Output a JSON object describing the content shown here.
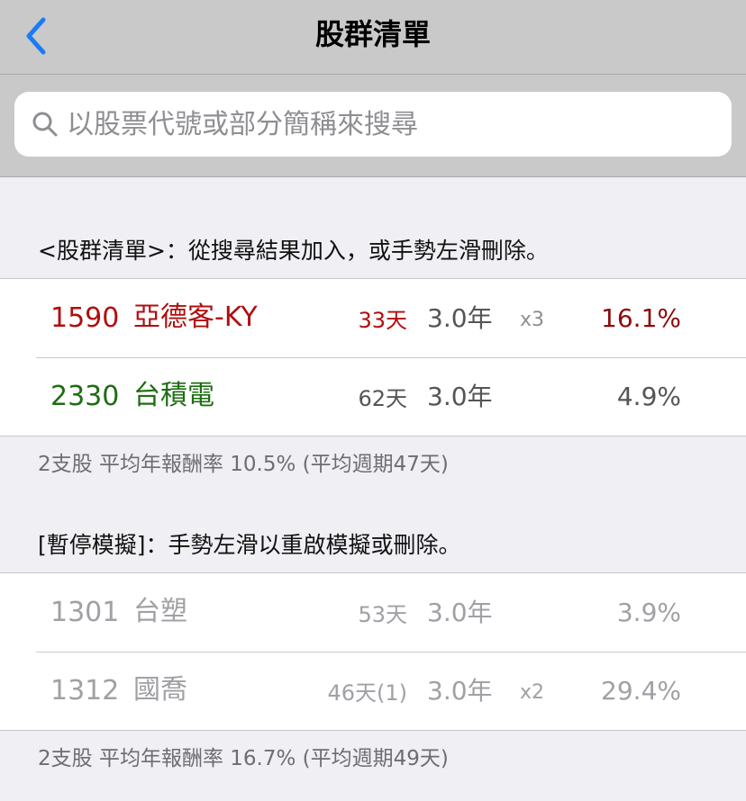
{
  "nav": {
    "title": "股群清單"
  },
  "search": {
    "placeholder": "以股票代號或部分簡稱來搜尋"
  },
  "group1": {
    "header": "<股群清單>：從搜尋結果加入，或手勢左滑刪除。",
    "rows": [
      {
        "code": "1590",
        "name": "亞德客-KY",
        "days": "33天",
        "period": "3.0年",
        "mult": "x3",
        "pct": "16.1%"
      },
      {
        "code": "2330",
        "name": "台積電",
        "days": "62天",
        "period": "3.0年",
        "mult": "",
        "pct": "4.9%"
      }
    ],
    "summary": "2支股 平均年報酬率 10.5% (平均週期47天)"
  },
  "group2": {
    "header": "[暫停模擬]：手勢左滑以重啟模擬或刪除。",
    "rows": [
      {
        "code": "1301",
        "name": "台塑",
        "days": "53天",
        "period": "3.0年",
        "mult": "",
        "pct": "3.9%"
      },
      {
        "code": "1312",
        "name": "國喬",
        "days": "46天(1)",
        "period": "3.0年",
        "mult": "x2",
        "pct": "29.4%"
      }
    ],
    "summary": "2支股 平均年報酬率 16.7% (平均週期49天)"
  },
  "colors": {
    "red": "#b00e0e",
    "dark_red": "#8c0b0b",
    "green": "#1e6d12",
    "gray_text": "#555555",
    "disabled": "#a0a0a5",
    "accent": "#1a7cf5"
  }
}
